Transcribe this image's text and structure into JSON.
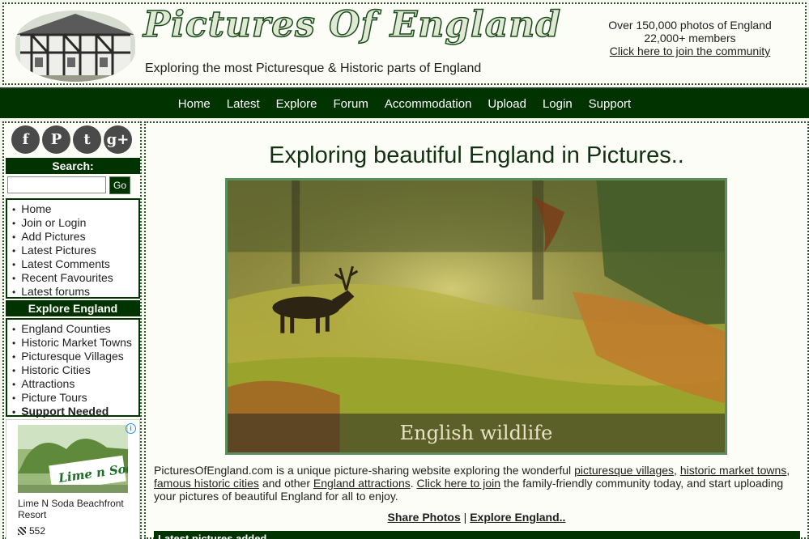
{
  "header": {
    "logo_text": "Pictures Of England",
    "tagline": "Exploring the most Picturesque & Historic parts of England",
    "stats_photos": "Over 150,000 photos of England",
    "stats_members": "22,000+ members",
    "join_link": "Click here to join the community"
  },
  "nav": {
    "items": [
      "Home",
      "Latest",
      "Explore",
      "Forum",
      "Accommodation",
      "Upload",
      "Login",
      "Support"
    ]
  },
  "sidebar": {
    "social": [
      {
        "icon": "facebook-icon",
        "glyph": "f"
      },
      {
        "icon": "pinterest-icon",
        "glyph": "P"
      },
      {
        "icon": "twitter-icon",
        "glyph": "t"
      },
      {
        "icon": "google-plus-icon",
        "glyph": "g+"
      }
    ],
    "search_heading": "Search:",
    "search_button": "Go",
    "links": [
      "Home",
      "Join or Login",
      "Add Pictures",
      "Latest Pictures",
      "Latest Comments",
      "Recent Favourites",
      "Latest forums"
    ],
    "explore_heading": "Explore England",
    "explore_links": [
      "England Counties",
      "Historic Market Towns",
      "Picturesque Villages",
      "Historic Cities",
      "Attractions",
      "Picture Tours",
      "Support Needed"
    ],
    "ad": {
      "sign_text": "Lime n Soda",
      "title": "Lime N Soda Beachfront Resort",
      "count": "552",
      "info_icon": "ad-info-icon"
    }
  },
  "main": {
    "title": "Exploring beautiful England in Pictures..",
    "hero_caption": "English wildlife",
    "intro": {
      "p1": "PicturesOfEngland.com is a unique picture-sharing website exploring the wonderful ",
      "l1": "picturesque villages",
      "p2": ", ",
      "l2": "historic market towns",
      "p3": ", ",
      "l3": "famous historic cities",
      "p4": " and other ",
      "l4": "England attractions",
      "p5": ". ",
      "l5": "Click here to join",
      "p6": " the family-friendly community today, and start uploading your pictures of beautiful England for all to enjoy."
    },
    "share_photos": "Share Photos",
    "separator": "|",
    "explore_england": "Explore England..",
    "latest_heading": "Latest pictures added"
  },
  "colors": {
    "nav_bg": "#003300",
    "page_bg": "#f2f6ec",
    "accent_border": "#5b8f5b"
  }
}
